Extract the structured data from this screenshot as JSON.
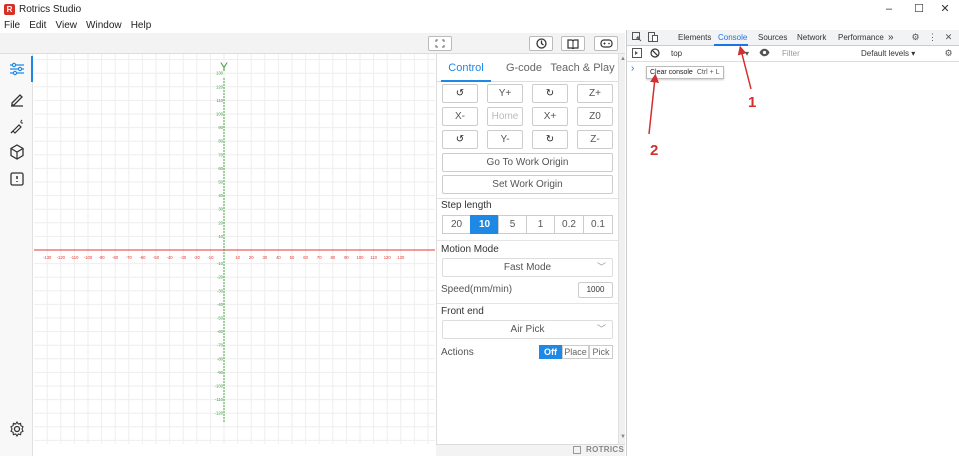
{
  "window": {
    "title": "Rotrics Studio",
    "controls": {
      "minimize": "–",
      "maximize": "☐",
      "close": "✕"
    }
  },
  "menu": [
    "File",
    "Edit",
    "View",
    "Window",
    "Help"
  ],
  "sidebar": {
    "items": [
      {
        "name": "sidebar-item-settings-sliders",
        "icon": "sliders-icon",
        "active": true
      },
      {
        "name": "sidebar-item-write-draw",
        "icon": "pencil-icon"
      },
      {
        "name": "sidebar-item-laser",
        "icon": "laser-icon"
      },
      {
        "name": "sidebar-item-3d-print",
        "icon": "cube-icon"
      },
      {
        "name": "sidebar-item-teach",
        "icon": "book-icon"
      },
      {
        "name": "sidebar-item-preferences",
        "icon": "gear-icon"
      }
    ]
  },
  "canvas": {
    "axis_y_label": "Y",
    "x_ticks_neg": [
      "-130",
      "-120",
      "-110",
      "-100",
      "-90",
      "-80",
      "-70",
      "-60",
      "-50",
      "-40",
      "-30",
      "-20",
      "-10"
    ],
    "x_ticks_pos": [
      "10",
      "20",
      "30",
      "40",
      "50",
      "60",
      "70",
      "80",
      "90",
      "100",
      "110",
      "120",
      "130"
    ],
    "y_ticks_pos": [
      "130",
      "120",
      "110",
      "100",
      "90",
      "80",
      "70",
      "60",
      "50",
      "40",
      "30",
      "20",
      "10"
    ],
    "y_ticks_neg": [
      "-10",
      "-20",
      "-30",
      "-40",
      "-50",
      "-60",
      "-70",
      "-80",
      "-90",
      "-100",
      "-110",
      "-120"
    ],
    "colors": {
      "x_axis": "#e53935",
      "y_axis": "#43a047",
      "grid": "#eeeeee"
    }
  },
  "panel": {
    "tabs": [
      "Control",
      "G-code",
      "Teach & Play"
    ],
    "jog": {
      "row1": [
        "↺",
        "Y+",
        "↻",
        "Z+"
      ],
      "row2": [
        "X-",
        "Home",
        "X+",
        "Z0"
      ],
      "row3": [
        "↺",
        "Y-",
        "↻",
        "Z-"
      ]
    },
    "go_to_work_origin": "Go To Work Origin",
    "set_work_origin": "Set Work Origin",
    "step_length_label": "Step length",
    "steps": [
      "20",
      "10",
      "5",
      "1",
      "0.2",
      "0.1"
    ],
    "active_step": "10",
    "motion_mode_label": "Motion Mode",
    "motion_mode_value": "Fast Mode",
    "speed_label": "Speed(mm/min)",
    "speed_value": "1000",
    "front_end_label": "Front end",
    "front_end_value": "Air Pick",
    "actions_label": "Actions",
    "actions": [
      "Off",
      "Place",
      "Pick"
    ],
    "active_action": "Off",
    "accent": "#1e88e5"
  },
  "footer": {
    "brand": "ROTRICS"
  },
  "devtools": {
    "tabs": [
      "Elements",
      "Console",
      "Sources",
      "Network",
      "Performance"
    ],
    "overflow": "»",
    "active_tab": "Console",
    "context": "top",
    "filter_placeholder": "Filter",
    "levels": "Default levels ▾",
    "prompt": "›",
    "tooltip_text": "Clear console",
    "tooltip_shortcut": "Ctrl + L"
  },
  "annotations": {
    "label_1": "1",
    "label_2": "2",
    "color": "#d32f2f"
  }
}
